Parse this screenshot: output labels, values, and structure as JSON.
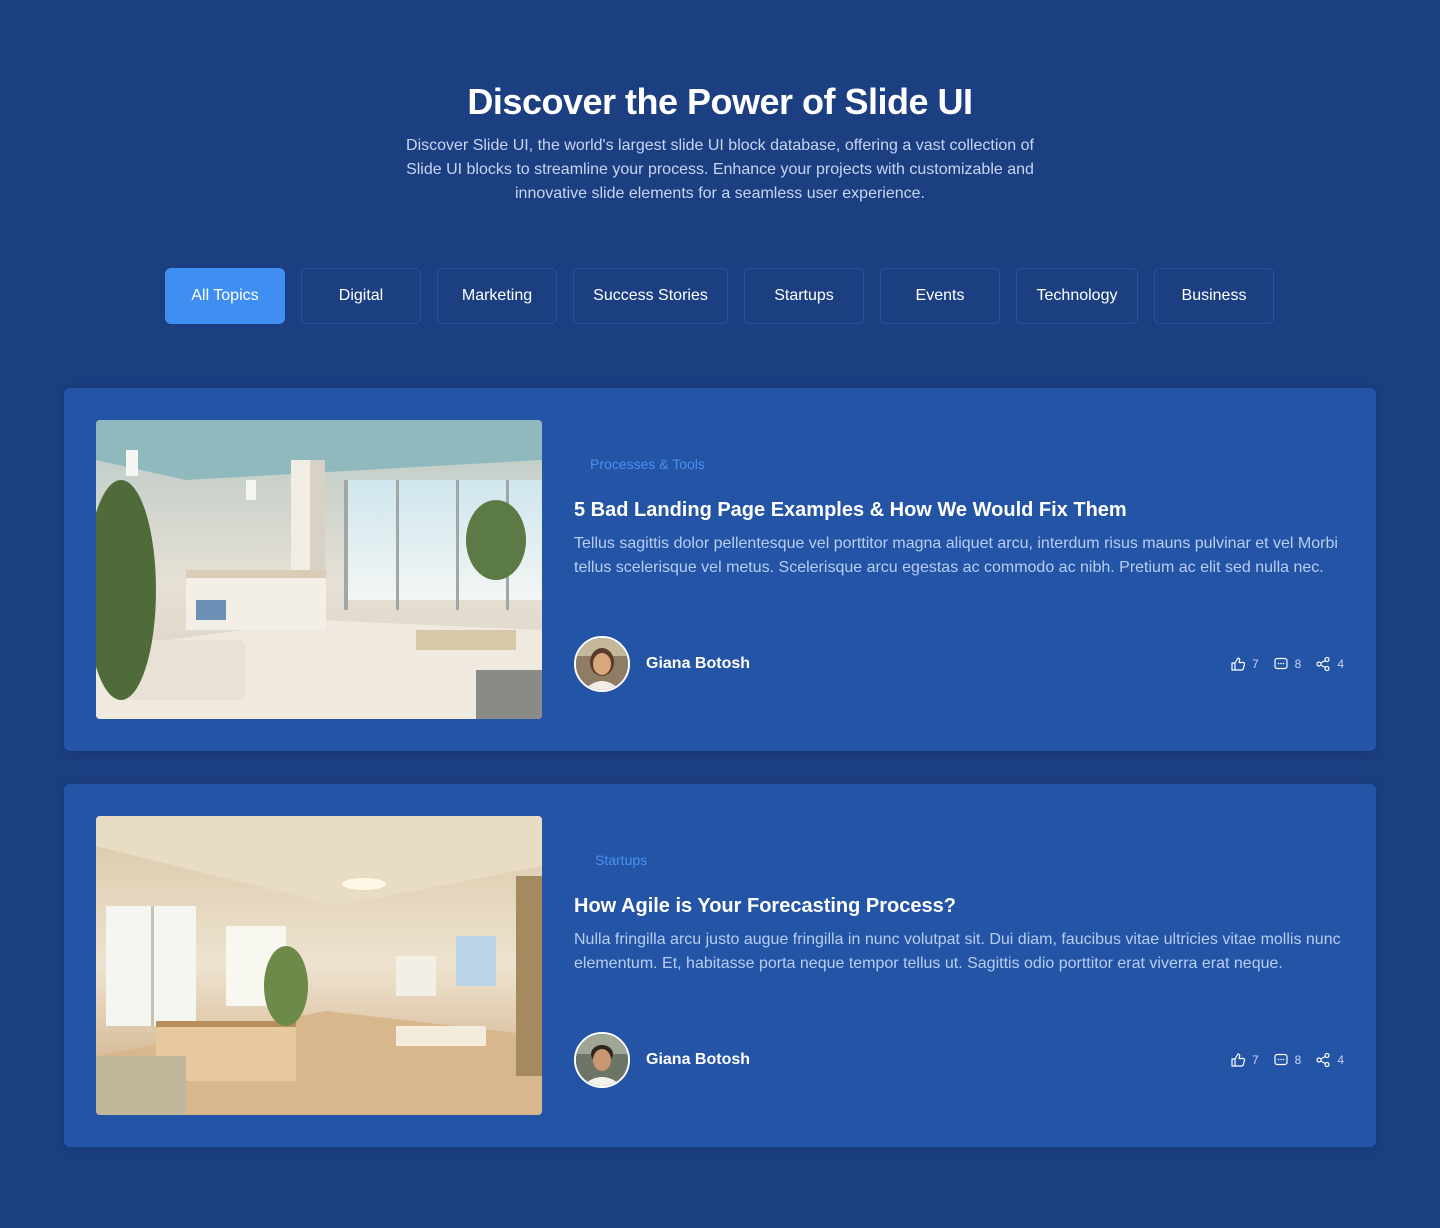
{
  "hero": {
    "title": "Discover the Power of Slide UI",
    "subtitle": "Discover Slide UI, the world's largest slide UI block database, offering a vast collection of Slide UI blocks to streamline your process. Enhance your projects with customizable and innovative slide elements for a seamless user experience."
  },
  "tabs": [
    {
      "label": "All Topics",
      "active": true
    },
    {
      "label": "Digital",
      "active": false
    },
    {
      "label": "Marketing",
      "active": false
    },
    {
      "label": "Success Stories",
      "active": false
    },
    {
      "label": "Startups",
      "active": false
    },
    {
      "label": "Events",
      "active": false
    },
    {
      "label": "Technology",
      "active": false
    },
    {
      "label": "Business",
      "active": false
    }
  ],
  "posts": [
    {
      "category": "Processes & Tools",
      "title": "5 Bad Landing Page Examples & How We Would Fix Them",
      "excerpt": "Tellus sagittis dolor pellentesque vel porttitor magna aliquet arcu, interdum risus mauns pulvinar et vel Morbi tellus scelerisque vel metus. Scelerisque arcu egestas ac commodo ac nibh. Pretium ac elit sed nulla nec.",
      "author": "Giana Botosh",
      "likes": "7",
      "comments": "8",
      "shares": "4"
    },
    {
      "category": "Startups",
      "title": "How Agile is Your Forecasting Process?",
      "excerpt": "Nulla fringilla arcu justo augue fringilla in nunc volutpat sit. Dui diam, faucibus vitae ultricies vitae mollis nunc elementum. Et, habitasse porta neque tempor tellus ut. Sagittis odio porttitor erat viverra erat neque.",
      "author": "Giana Botosh",
      "likes": "7",
      "comments": "8",
      "shares": "4"
    }
  ],
  "colors": {
    "background": "#1c3f82",
    "card": "#2354a6",
    "accent": "#3f8ff3",
    "category": "#4a8ff0"
  },
  "icons": {
    "like": "thumbs-up-icon",
    "comment": "comment-icon",
    "share": "share-icon"
  }
}
